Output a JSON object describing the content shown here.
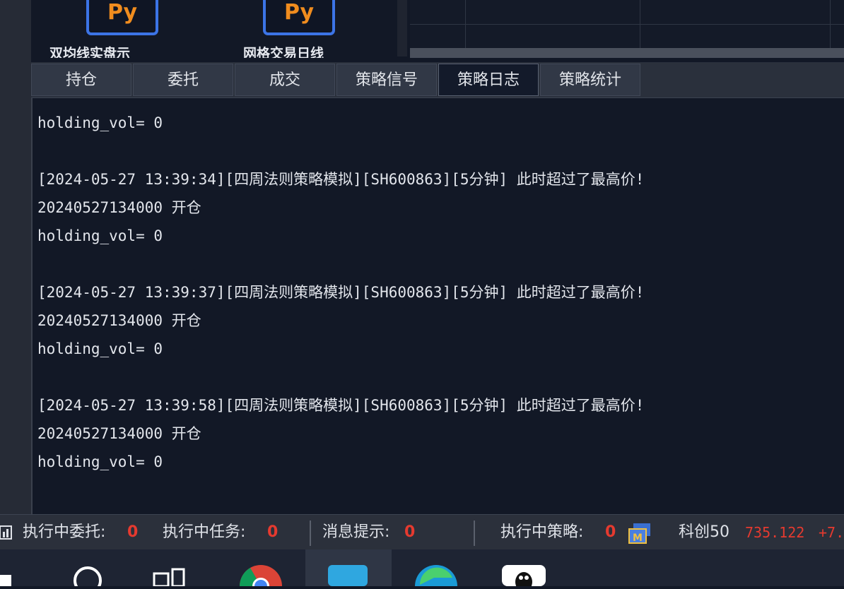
{
  "top_tiles": [
    {
      "icon_text": "Py",
      "caption": "双均线实盘示"
    },
    {
      "icon_text": "Py",
      "caption": "网格交易日线"
    }
  ],
  "tabs": [
    {
      "label": "持仓",
      "active": false
    },
    {
      "label": "委托",
      "active": false
    },
    {
      "label": "成交",
      "active": false
    },
    {
      "label": "策略信号",
      "active": false
    },
    {
      "label": "策略日志",
      "active": true
    },
    {
      "label": "策略统计",
      "active": false
    }
  ],
  "log_lines": [
    "holding_vol= 0",
    "",
    "[2024-05-27 13:39:34][四周法则策略模拟][SH600863][5分钟] 此时超过了最高价!",
    "20240527134000 开仓",
    "holding_vol= 0",
    "",
    "[2024-05-27 13:39:37][四周法则策略模拟][SH600863][5分钟] 此时超过了最高价!",
    "20240527134000 开仓",
    "holding_vol= 0",
    "",
    "[2024-05-27 13:39:58][四周法则策略模拟][SH600863][5分钟] 此时超过了最高价!",
    "20240527134000 开仓",
    "holding_vol= 0"
  ],
  "status": {
    "orders_label": "执行中委托:",
    "orders_value": "0",
    "tasks_label": "执行中任务:",
    "tasks_value": "0",
    "msg_label": "消息提示:",
    "msg_value": "0",
    "strategy_label": "执行中策略:",
    "strategy_value": "0",
    "index_name": "科创50",
    "index_value": "735.122",
    "index_change": "+7."
  },
  "colors": {
    "accent_red": "#e53a2f",
    "py_orange": "#f08c1e",
    "tile_blue": "#3c74e6"
  },
  "taskbar_icons": [
    "start-icon",
    "search-icon",
    "task-view-icon",
    "chrome-icon",
    "app-icon",
    "edge-icon",
    "qq-icon"
  ]
}
